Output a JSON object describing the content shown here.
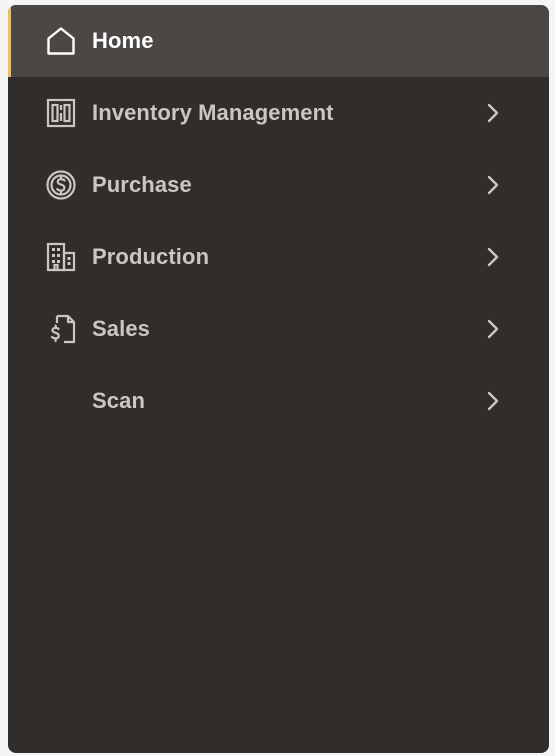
{
  "colors": {
    "panel_background": "#312d2b",
    "active_background": "#4b4745",
    "active_indicator": "#f0c05a",
    "label_color": "#c9c6c3",
    "active_label_color": "#ffffff"
  },
  "nav": {
    "items": [
      {
        "label": "Home",
        "icon": "home-icon",
        "active": true,
        "has_submenu": false
      },
      {
        "label": "Inventory Management",
        "icon": "inventory-icon",
        "active": false,
        "has_submenu": true
      },
      {
        "label": "Purchase",
        "icon": "dollar-circle-icon",
        "active": false,
        "has_submenu": true
      },
      {
        "label": "Production",
        "icon": "building-icon",
        "active": false,
        "has_submenu": true
      },
      {
        "label": "Sales",
        "icon": "sales-document-icon",
        "active": false,
        "has_submenu": true
      },
      {
        "label": "Scan",
        "icon": "",
        "active": false,
        "has_submenu": true
      }
    ]
  }
}
